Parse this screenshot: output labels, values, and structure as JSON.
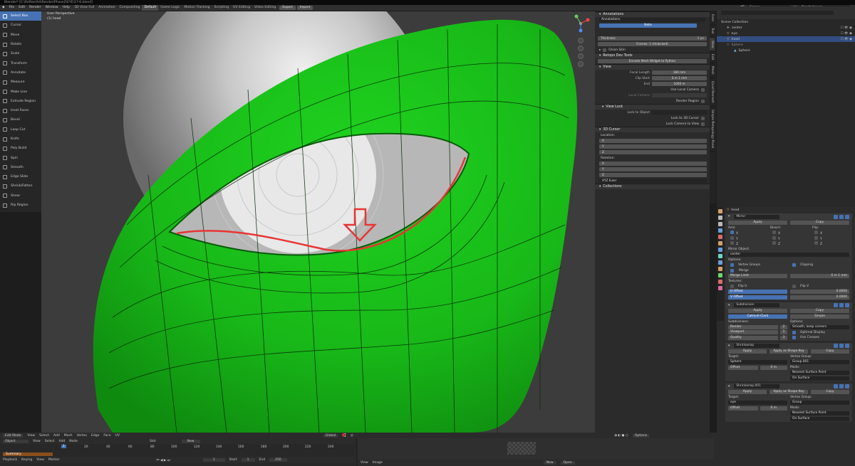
{
  "window": {
    "title": "Blender* [C:\\Reflex\\Art\\Render\\Phase2\\EYE\\17-6.blend]"
  },
  "menu": {
    "items": [
      "File",
      "Edit",
      "Render",
      "Window",
      "Help"
    ],
    "workspaces": [
      "3D View Full",
      "Animation",
      "Compositing",
      "Default",
      "Game Logic",
      "Motion Tracking",
      "Scripting",
      "UV Editing",
      "Video Editing"
    ],
    "active_workspace": "Default",
    "export": "Export",
    "import": "Import",
    "scene": "Scene",
    "render_layer": "RenderLayer"
  },
  "toolbar": {
    "items": [
      "Select Box",
      "Cursor",
      "Move",
      "Rotate",
      "Scale",
      "Transform",
      "Annotate",
      "Measure",
      "Make Line",
      "Extrude Region",
      "Inset Faces",
      "Bevel",
      "Loop Cut",
      "Knife",
      "Poly Build",
      "Spin",
      "Smooth",
      "Edge Slide",
      "Shrink/Fatten",
      "Shear",
      "Rip Region"
    ],
    "active": "Select Box"
  },
  "viewport": {
    "perspective": "User Perspective",
    "object": "(1) head"
  },
  "props": {
    "annotations": {
      "header": "Annotations",
      "layer": "Annotations",
      "note": "Note",
      "thickness_label": "Thickness",
      "thickness": "3 px",
      "frames": "Frames: 1 (Unlocked)",
      "onion": "Onion Skin"
    },
    "retopo": {
      "header": "Retopo Dev Tools",
      "button": "Encode Mesh Widget to Python"
    },
    "view": {
      "header": "View",
      "focal_label": "Focal Length",
      "focal": "180 mm",
      "clip_start_label": "Clip Start",
      "clip_start": "0 m 1 mm",
      "end_label": "End",
      "end": "1000 m",
      "use_local_camera": "Use Local Camera",
      "local_camera": "Local Camera",
      "render_region": "Render Region"
    },
    "view_lock": {
      "header": "View Lock",
      "lock_object": "Lock to Object",
      "lock_cursor": "Lock to 3D Cursor",
      "lock_camera": "Lock Camera to View"
    },
    "cursor": {
      "header": "3D Cursor",
      "location": "Location:",
      "rotation": "Rotation:",
      "x": "X",
      "y": "Y",
      "z": "Z",
      "loc_val": "0 m",
      "rot_val": "0°",
      "mode": "XYZ Euler"
    },
    "collections": {
      "header": "Collections"
    }
  },
  "side_tabs": [
    "Item",
    "Tool",
    "View",
    "Edit",
    "Mesh",
    "Quad Remesh",
    "Simple Retopology Panel"
  ],
  "outliner": {
    "rows": [
      {
        "label": "Scene Collection",
        "indent": 0,
        "selected": false
      },
      {
        "label": "center",
        "indent": 1,
        "selected": false
      },
      {
        "label": "eye",
        "indent": 1,
        "selected": false
      },
      {
        "label": "head",
        "indent": 1,
        "selected": true
      },
      {
        "label": "Sphere",
        "indent": 1,
        "selected": false
      },
      {
        "label": "Sphere",
        "indent": 2,
        "selected": false
      }
    ]
  },
  "modifiers": {
    "object": "head",
    "mirror": {
      "name": "Mirror",
      "apply": "Apply",
      "copy": "Copy",
      "axis": "Axis:",
      "bisect": "Bisect:",
      "flip": "Flip:",
      "x": "X",
      "y": "Y",
      "z": "Z",
      "mirror_object": "Mirror Object:",
      "center": "center",
      "options": "Options:",
      "vertex_groups": "Vertex Groups",
      "clipping": "Clipping",
      "merge": "Merge",
      "merge_limit": "Merge Limit",
      "merge_val": "0 m 1 mm",
      "textures": "Textures:",
      "flip_u": "Flip U",
      "flip_v": "Flip V",
      "u_offset": "U Offset",
      "v_offset": "V Offset",
      "offset_val": "0.0000"
    },
    "subdivision": {
      "name": "Subdivision",
      "apply": "Apply",
      "copy": "Copy",
      "catmull": "Catmull-Clark",
      "simple": "Simple",
      "subdivisions": "Subdivisions:",
      "render": "Render",
      "render_val": "2",
      "viewport": "Viewport",
      "viewport_val": "1",
      "quality": "Quality",
      "quality_val": "3",
      "options": "Options:",
      "smooth": "Smooth, keep corners",
      "optimal": "Optimal Display",
      "creases": "Use Creases"
    },
    "shrinkwrap1": {
      "name": "Shrinkwrap",
      "apply": "Apply",
      "apply_shape": "Apply as Shape Key",
      "copy": "Copy",
      "target": "Target:",
      "target_val": "Sphere",
      "vgroup": "Vertex Group:",
      "vgroup_val": "Group.001",
      "offset": "Offset",
      "offset_val": "0 m",
      "mode": "Mode:",
      "mode_val": "Nearest Surface Point",
      "on_surface": "On Surface"
    },
    "shrinkwrap2": {
      "name": "Shrinkwrap.001",
      "apply": "Apply",
      "apply_shape": "Apply as Shape Key",
      "copy": "Copy",
      "target": "Target:",
      "target_val": "eye",
      "vgroup": "Vertex Group:",
      "vgroup_val": "Group",
      "offset": "Offset",
      "offset_val": "0 m",
      "mode": "Mode:",
      "mode_val": "Nearest Surface Point",
      "on_surface": "On Surface"
    }
  },
  "header3d": {
    "mode": "Edit Mode",
    "items": [
      "View",
      "Select",
      "Add",
      "Mesh",
      "Vertex",
      "Edge",
      "Face",
      "UV"
    ],
    "orientation": "Global",
    "options": "Options"
  },
  "timeline": {
    "mode": "Object",
    "view": "View",
    "select": "Select",
    "add": "Add",
    "node": "Node",
    "slot": "Slot",
    "new": "New",
    "ticks": [
      "1",
      "20",
      "40",
      "60",
      "80",
      "100",
      "120",
      "140",
      "160",
      "180",
      "200",
      "220",
      "240"
    ],
    "summary": "Summary",
    "playback": "Playback",
    "keying": "Keying",
    "marker": "Marker",
    "current_frame": "1",
    "start_label": "Start",
    "start": "1",
    "end_label": "End",
    "end": "250"
  },
  "uv": {
    "view": "View",
    "image": "Image",
    "new": "New",
    "open": "Open"
  },
  "colors": {
    "green_mesh": "#1fd31f",
    "accent": "#4772b3",
    "red_curve": "#e83535"
  }
}
